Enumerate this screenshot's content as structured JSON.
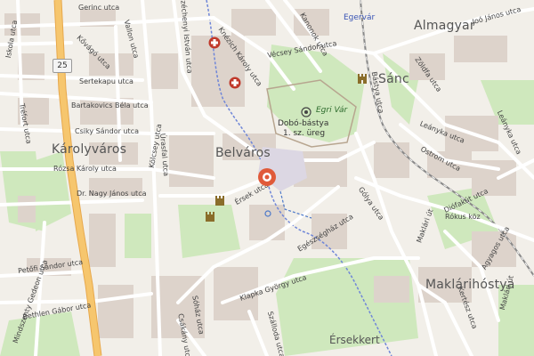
{
  "map": {
    "districts": {
      "almagyar": "Almagyar",
      "sanc": "Sánc",
      "karolyvaros": "Károlyváros",
      "belvaros": "Belváros",
      "maklarihostya": "Maklárihóstya",
      "ersekkert": "Érsekkert"
    },
    "pois": {
      "egervar": "Egervár",
      "egri_var": "Egri Vár",
      "dobo_bastya": "Dobó-bástya",
      "urege": "1. sz. üreg"
    },
    "road_shield": "25",
    "streets": {
      "gerinc": "Gerinc utca",
      "kovago": "Kővágó utca",
      "iskola": "Iskola utca",
      "sertekapu": "Sertekapu utca",
      "bartakovics": "Bartakovics Béla utca",
      "csiky": "Csiky Sándor utca",
      "trastovedi": "Tréfort utca",
      "rozsa": "Rózsa Károly utca",
      "dr_nagy": "Dr. Nagy János utca",
      "petofi": "Petőfi Sándor utca",
      "bethlen": "Bethlen Gábor utca",
      "mindszenty": "Mindszenty Gedeon utca",
      "kolcsey": "Kölcsey utca",
      "vallon": "Vallon utca",
      "szechenyi": "Széchenyi István utca",
      "knezich": "Knézich Károly utca",
      "kanonok": "Kanonok utca",
      "vecsey": "Vécsey Sándor utca",
      "joo": "Joó János utca",
      "zoldfa": "Zöldfa utca",
      "leanyka_top": "Leányka utca",
      "leanyka_side": "Leányka utca",
      "ostrom": "Ostrom utca",
      "bastya": "Bástya utca",
      "urasfal": "Úrasfal utca",
      "ersek": "Érsek utca",
      "golya": "Gólya utca",
      "egeszseghaz": "Egészségház utca",
      "makiar": "Maklári út",
      "rokus": "Rókus köz",
      "diofakut": "Diófakút utca",
      "agyagos": "Agyagos utca",
      "maklari_bot": "Maklári út",
      "kertesz": "Kertész utca",
      "klapka": "Klapka György utca",
      "sozhaz": "Sóház utca",
      "szalloda": "Szálloda utca",
      "csakany": "Csákány utca"
    }
  },
  "colors": {
    "background": "#f2efe9",
    "major_road": "#f6c66e",
    "street": "#ffffff",
    "park": "#c8e6b2",
    "building": "#d9d0c9",
    "water": "#6f86d8",
    "hospital": "#c0392b",
    "pin": "#e05a3a"
  },
  "icons": [
    "hospital-icon",
    "castle-icon",
    "map-pin-icon",
    "viewpoint-icon"
  ]
}
